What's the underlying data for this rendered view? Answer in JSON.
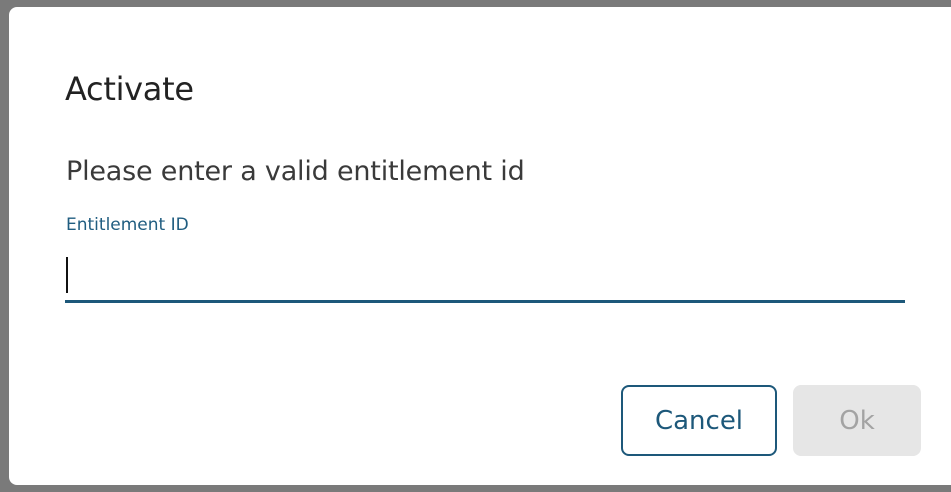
{
  "dialog": {
    "title": "Activate",
    "message": "Please enter a valid entitlement id",
    "field": {
      "label": "Entitlement ID",
      "value": "",
      "placeholder": ""
    },
    "buttons": {
      "cancel_label": "Cancel",
      "ok_label": "Ok",
      "ok_disabled": true
    }
  },
  "colors": {
    "accent": "#1d587a",
    "backdrop": "#7a7a7a",
    "disabled_bg": "#e6e6e6",
    "disabled_text": "#a3a3a3"
  }
}
